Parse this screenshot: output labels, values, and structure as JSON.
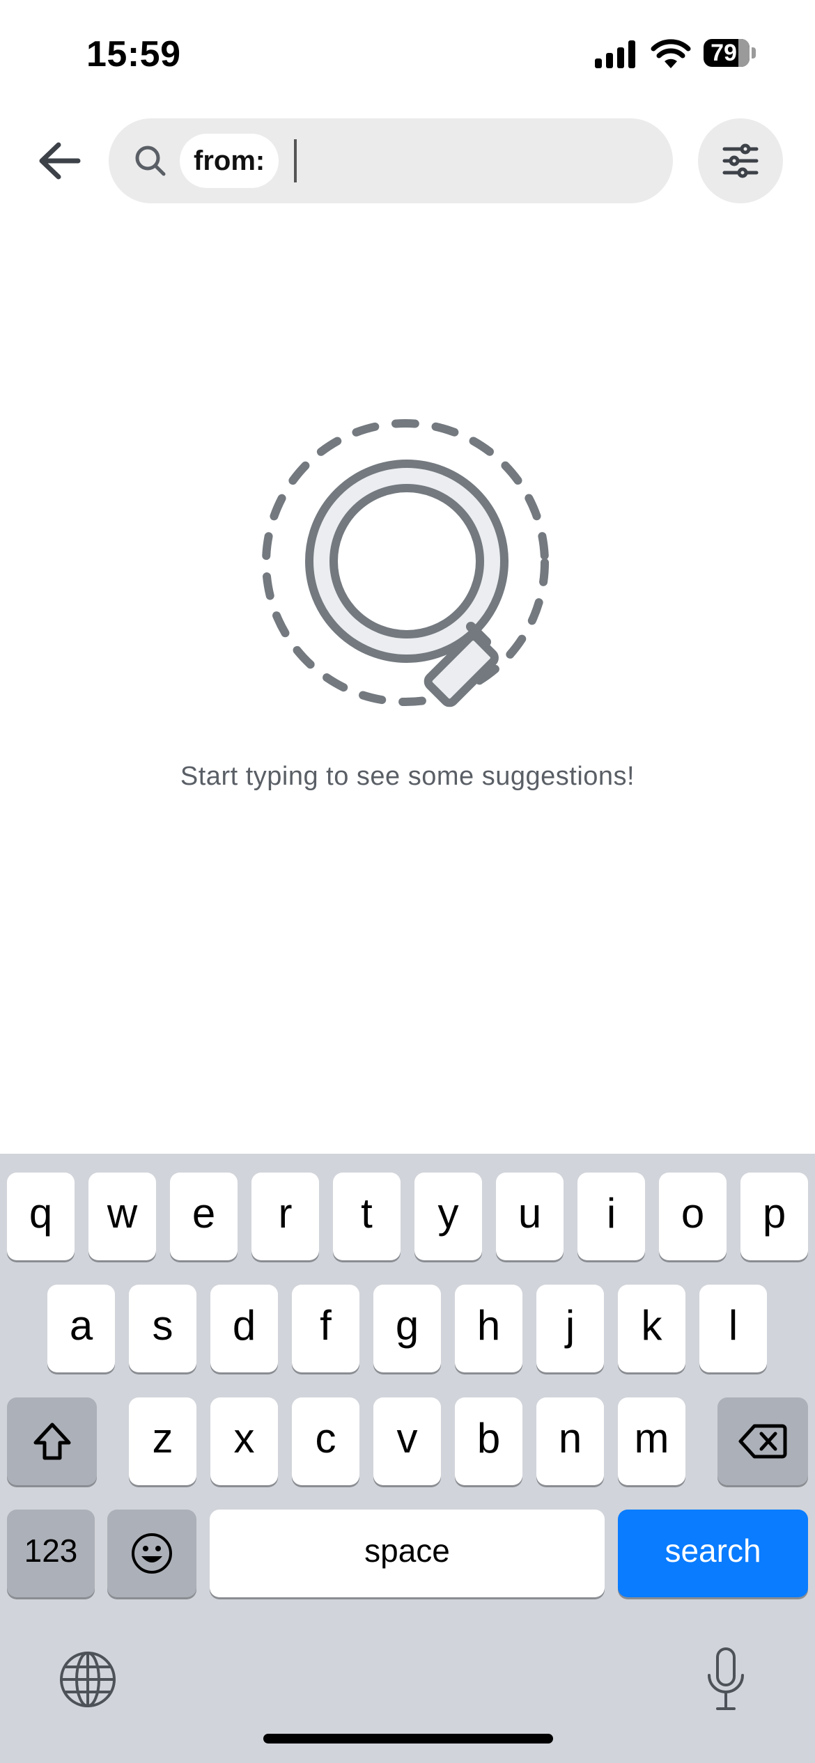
{
  "status_bar": {
    "time": "15:59",
    "battery": "79"
  },
  "search": {
    "chip_label": "from:",
    "query": ""
  },
  "empty_state": {
    "message": "Start typing to see some suggestions!"
  },
  "keyboard": {
    "row1": [
      "q",
      "w",
      "e",
      "r",
      "t",
      "y",
      "u",
      "i",
      "o",
      "p"
    ],
    "row2": [
      "a",
      "s",
      "d",
      "f",
      "g",
      "h",
      "j",
      "k",
      "l"
    ],
    "row3": [
      "z",
      "x",
      "c",
      "v",
      "b",
      "n",
      "m"
    ],
    "numbers_label": "123",
    "space_label": "space",
    "search_label": "search"
  },
  "icons": {
    "back": "arrow-left-icon",
    "search": "search-icon",
    "filter": "sliders-icon",
    "shift": "shift-icon",
    "delete": "backspace-icon",
    "emoji": "emoji-icon",
    "globe": "globe-icon",
    "mic": "microphone-icon"
  },
  "colors": {
    "accent": "#0a7cff",
    "search_bg": "#ebebeb",
    "keyboard_bg": "#d1d4da"
  }
}
